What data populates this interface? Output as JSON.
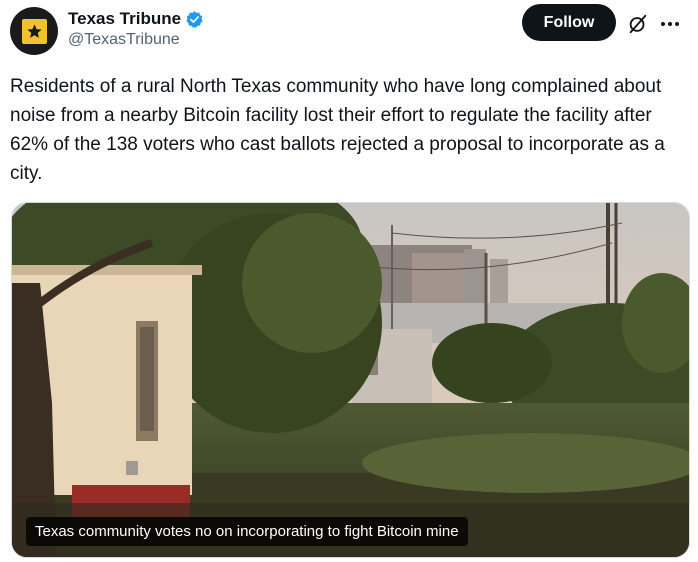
{
  "account": {
    "display_name": "Texas Tribune",
    "handle": "@TexasTribune",
    "verified": true,
    "avatar_icon": "star-icon"
  },
  "actions": {
    "follow_label": "Follow",
    "grok_icon": "grok-icon",
    "more_icon": "more-icon"
  },
  "tweet": {
    "text": "Residents of a rural North Texas community who have long complained about noise from a nearby Bitcoin facility lost their effort to regulate the facility after 62% of the 138 voters who cast ballots rejected a proposal to incorporate as a city."
  },
  "card": {
    "caption": "Texas community votes no on incorporating to fight Bitcoin mine"
  },
  "colors": {
    "accent": "#1d9bf0",
    "follow_bg": "#0f1419",
    "avatar_bg": "#1a1a1a",
    "avatar_star": "#f2c12e"
  }
}
